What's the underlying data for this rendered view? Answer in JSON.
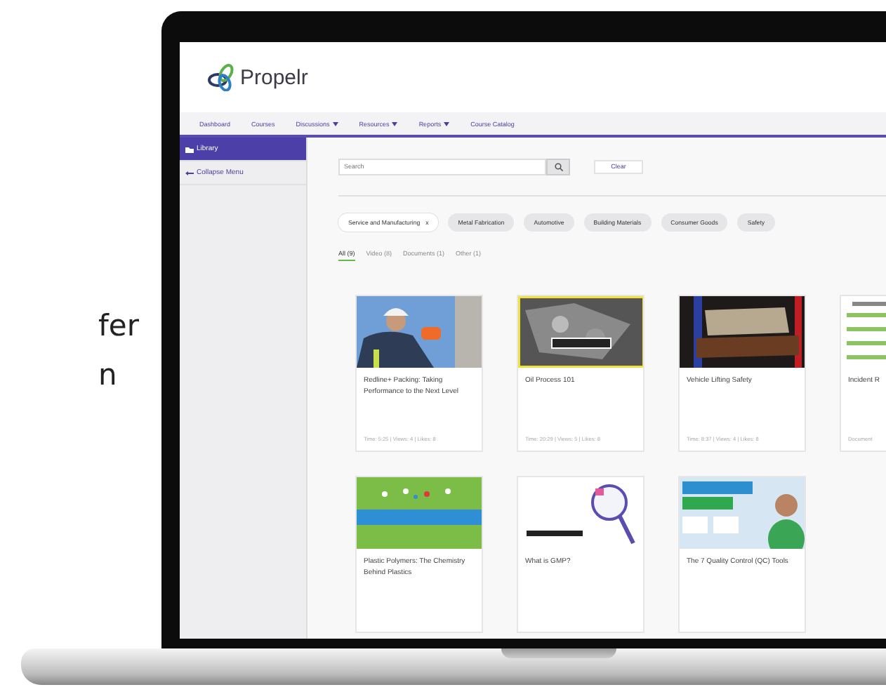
{
  "side_text": [
    "fer",
    "n"
  ],
  "app": {
    "logo": "Propelr",
    "nav": [
      {
        "label": "Dashboard",
        "dropdown": false
      },
      {
        "label": "Courses",
        "dropdown": false
      },
      {
        "label": "Discussions",
        "dropdown": true
      },
      {
        "label": "Resources",
        "dropdown": true
      },
      {
        "label": "Reports",
        "dropdown": true
      },
      {
        "label": "Course Catalog",
        "dropdown": false
      }
    ],
    "sidebar": {
      "items": [
        {
          "label": "Library",
          "kind": "folder",
          "selected": true
        },
        {
          "label": "Collapse Menu",
          "kind": "collapse",
          "selected": false
        }
      ]
    },
    "search": {
      "placeholder": "Search",
      "clear": "Clear"
    },
    "filters": [
      {
        "label": "Service and Manufacturing",
        "selected": true,
        "remove": "x"
      },
      {
        "label": "Metal Fabrication",
        "selected": false
      },
      {
        "label": "Automotive",
        "selected": false
      },
      {
        "label": "Building Materials",
        "selected": false
      },
      {
        "label": "Consumer Goods",
        "selected": false
      },
      {
        "label": "Safety",
        "selected": false
      }
    ],
    "tabs": [
      {
        "label": "All (9)",
        "selected": true
      },
      {
        "label": "Video (8)",
        "selected": false
      },
      {
        "label": "Documents (1)",
        "selected": false
      },
      {
        "label": "Other (1)",
        "selected": false
      }
    ],
    "cards": [
      [
        {
          "title": "Redline+ Packing: Taking Performance to the Next Level",
          "meta": "Time: 5:25 | Views: 4 | Likes: 8",
          "kind": "picture"
        },
        {
          "title": "Oil Process 101",
          "meta": "Time: 20:29 | Views: 5 | Likes: 8",
          "kind": "picture"
        },
        {
          "title": "Vehicle Lifting Safety",
          "meta": "Time: 8:37 | Views: 4 | Likes: 8",
          "kind": "picture"
        },
        {
          "title": "Incident R",
          "meta": "Document",
          "kind": "picture"
        }
      ],
      [
        {
          "title": "Plastic Polymers: The Chemistry Behind Plastics",
          "kind": "picture"
        },
        {
          "title": "What is GMP?",
          "kind": "picture"
        },
        {
          "title": "The 7 Quality Control (QC) Tools",
          "kind": "picture"
        }
      ]
    ]
  }
}
